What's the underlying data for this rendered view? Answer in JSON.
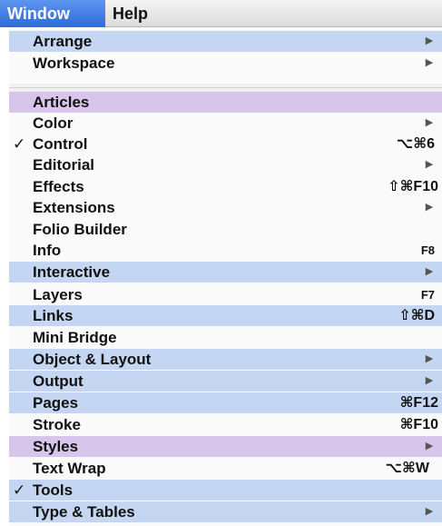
{
  "menubar": {
    "window_label": "Window",
    "help_label": "Help"
  },
  "menu": {
    "group1": [
      {
        "label": "Arrange",
        "submenu": true,
        "highlight": "blue"
      },
      {
        "label": "Workspace",
        "submenu": true,
        "highlight": "none"
      }
    ],
    "group2": [
      {
        "label": "Articles",
        "highlight": "purple"
      },
      {
        "label": "Color",
        "submenu": true
      },
      {
        "label": "Control",
        "checked": true,
        "shortcut": "⌥⌘6"
      },
      {
        "label": "Editorial",
        "submenu": true
      },
      {
        "label": "Effects",
        "shortcut": "⇧⌘F10"
      },
      {
        "label": "Extensions",
        "submenu": true
      },
      {
        "label": "Folio Builder"
      },
      {
        "label": "Info",
        "shortcut": "F8"
      },
      {
        "label": "Interactive",
        "submenu": true,
        "highlight": "blue"
      },
      {
        "label": "Layers",
        "shortcut": "F7"
      },
      {
        "label": "Links",
        "shortcut": "⇧⌘D",
        "highlight": "blue"
      },
      {
        "label": "Mini Bridge"
      },
      {
        "label": "Object & Layout",
        "submenu": true,
        "highlight": "blue"
      },
      {
        "label": "Output",
        "submenu": true,
        "highlight": "blue"
      },
      {
        "label": "Pages",
        "shortcut": "⌘F12",
        "highlight": "blue"
      },
      {
        "label": "Stroke",
        "shortcut": "⌘F10"
      },
      {
        "label": "Styles",
        "submenu": true,
        "highlight": "purple"
      },
      {
        "label": "Text Wrap",
        "shortcut": "⌥⌘W"
      },
      {
        "label": "Tools",
        "checked": true,
        "highlight": "blue"
      },
      {
        "label": "Type & Tables",
        "submenu": true,
        "highlight": "blue"
      }
    ]
  },
  "glyphs": {
    "check": "✓",
    "submenu_arrow": "▶"
  },
  "colors": {
    "menubar_active": "#3a74e0",
    "highlight_blue": "#c5d6f2",
    "highlight_purple": "#d7c5ec"
  }
}
